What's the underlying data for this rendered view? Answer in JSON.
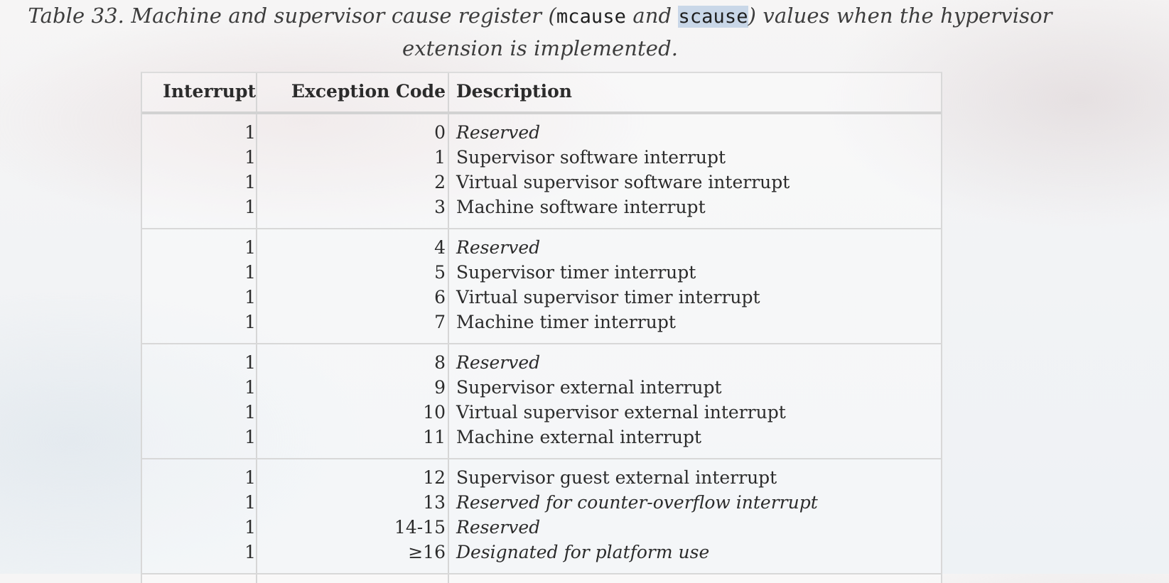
{
  "caption": {
    "prefix": "Table 33. Machine and supervisor cause register (",
    "reg1": "mcause",
    "middle": " and ",
    "reg2": "scause",
    "suffix": ") values when the hypervisor extension is implemented."
  },
  "table": {
    "headers": {
      "interrupt": "Interrupt",
      "exception_code": "Exception Code",
      "description": "Description"
    },
    "groups": [
      [
        {
          "interrupt": "1",
          "code": "0",
          "description": "Reserved"
        },
        {
          "interrupt": "1",
          "code": "1",
          "description": "Supervisor software interrupt"
        },
        {
          "interrupt": "1",
          "code": "2",
          "description": "Virtual supervisor software interrupt"
        },
        {
          "interrupt": "1",
          "code": "3",
          "description": "Machine software interrupt"
        }
      ],
      [
        {
          "interrupt": "1",
          "code": "4",
          "description": "Reserved"
        },
        {
          "interrupt": "1",
          "code": "5",
          "description": "Supervisor timer interrupt"
        },
        {
          "interrupt": "1",
          "code": "6",
          "description": "Virtual supervisor timer interrupt"
        },
        {
          "interrupt": "1",
          "code": "7",
          "description": "Machine timer interrupt"
        }
      ],
      [
        {
          "interrupt": "1",
          "code": "8",
          "description": "Reserved"
        },
        {
          "interrupt": "1",
          "code": "9",
          "description": "Supervisor external interrupt"
        },
        {
          "interrupt": "1",
          "code": "10",
          "description": "Virtual supervisor external interrupt"
        },
        {
          "interrupt": "1",
          "code": "11",
          "description": "Machine external interrupt"
        }
      ],
      [
        {
          "interrupt": "1",
          "code": "12",
          "description": "Supervisor guest external interrupt"
        },
        {
          "interrupt": "1",
          "code": "13",
          "description": "Reserved for counter-overflow interrupt"
        },
        {
          "interrupt": "1",
          "code": "14-15",
          "description": "Reserved"
        },
        {
          "interrupt": "1",
          "code": "≥16",
          "description": "Designated for platform use"
        }
      ]
    ]
  }
}
